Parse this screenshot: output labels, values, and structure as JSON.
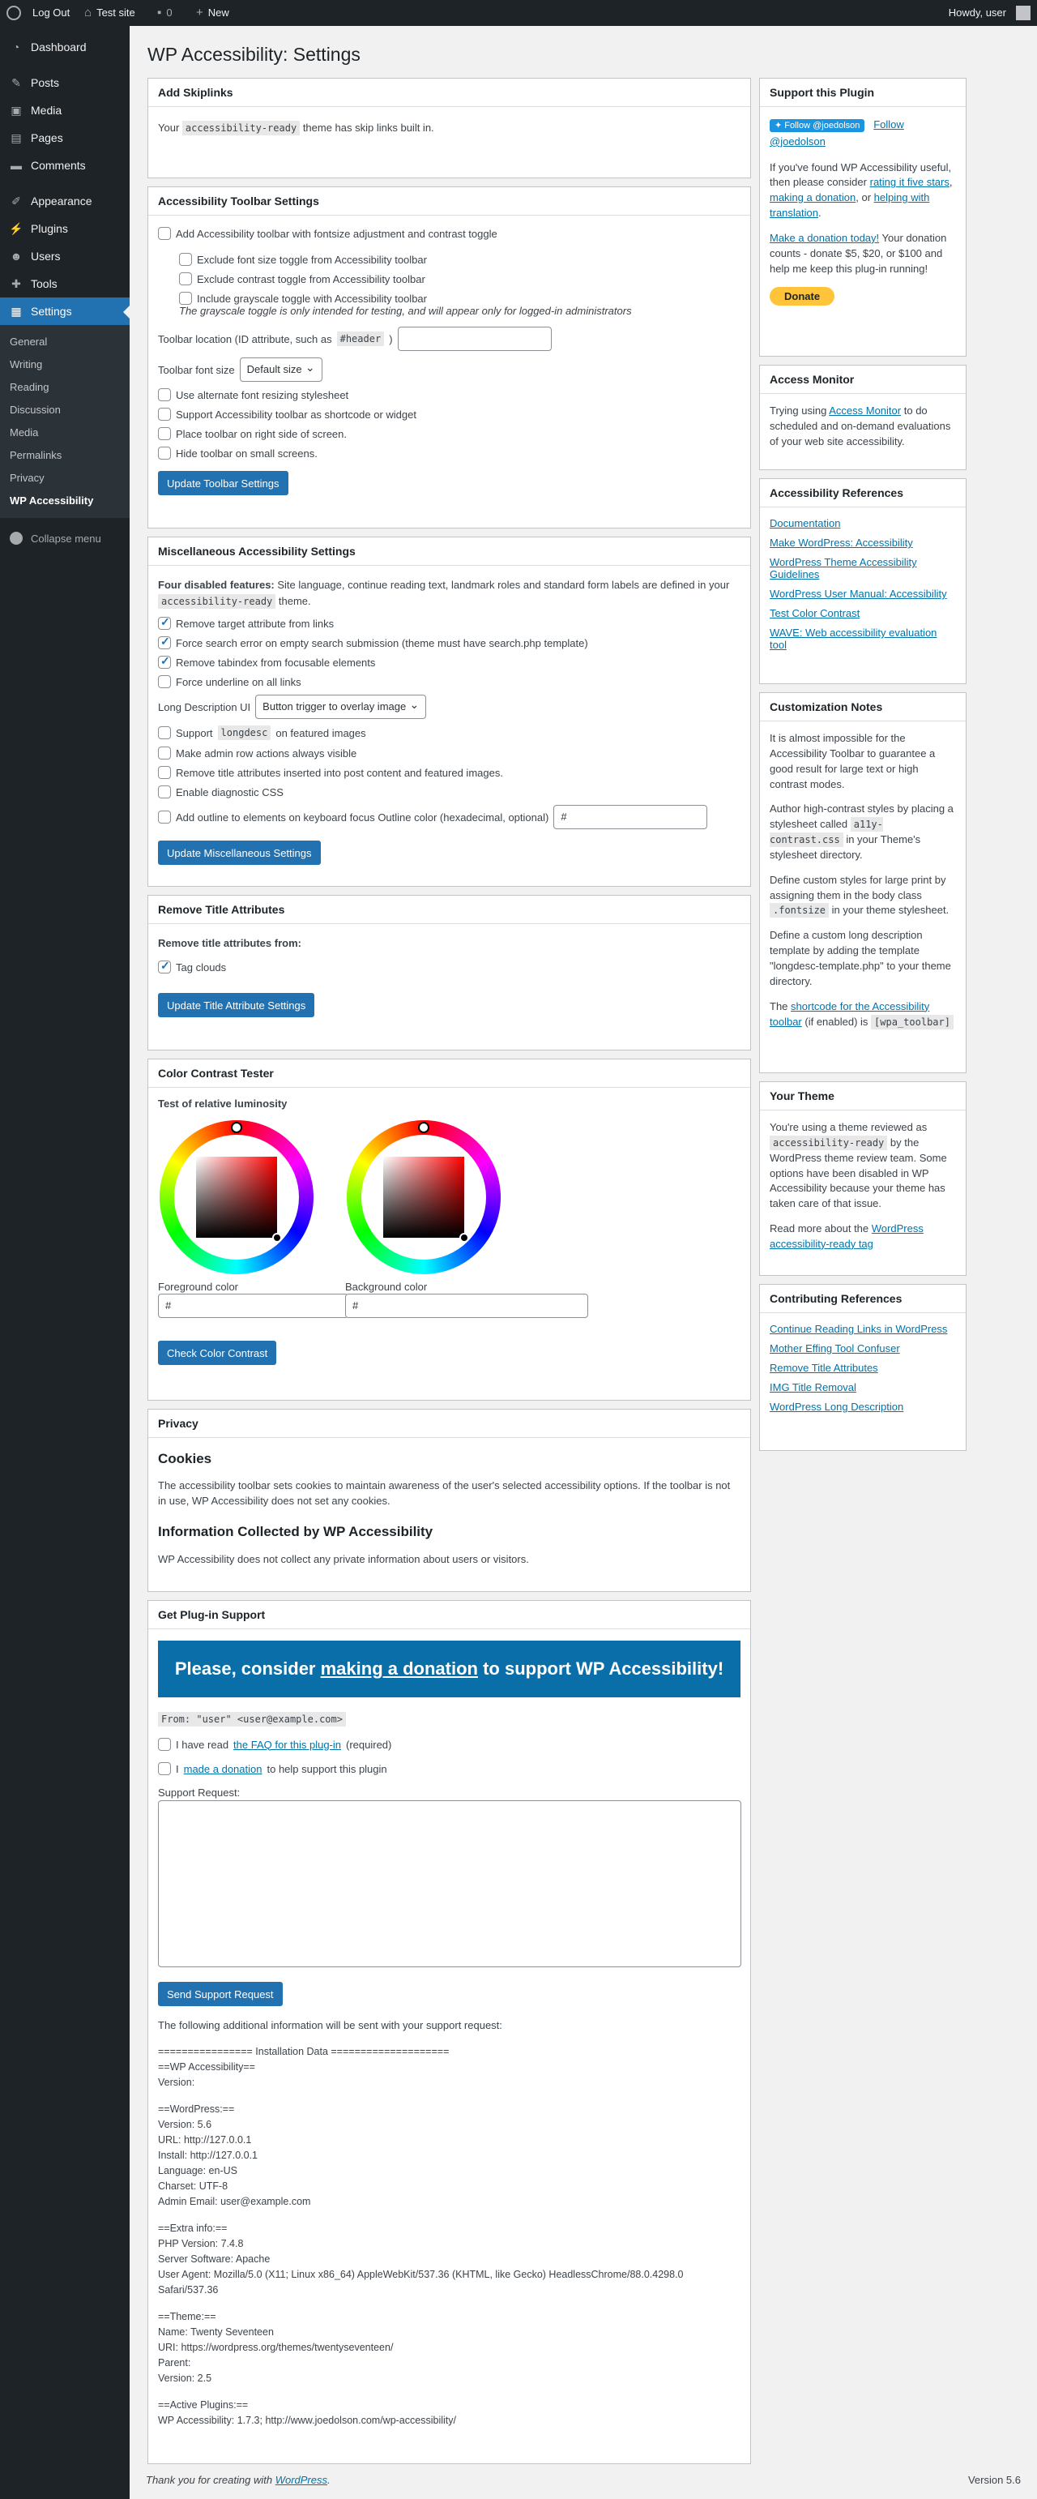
{
  "adminbar": {
    "logout": "Log Out",
    "site": "Test site",
    "comments": "0",
    "new": "New",
    "howdy": "Howdy, user"
  },
  "menu": {
    "dashboard": "Dashboard",
    "posts": "Posts",
    "media": "Media",
    "pages": "Pages",
    "comments": "Comments",
    "appearance": "Appearance",
    "plugins": "Plugins",
    "users": "Users",
    "tools": "Tools",
    "settings": "Settings",
    "collapse": "Collapse menu",
    "sub": [
      "General",
      "Writing",
      "Reading",
      "Discussion",
      "Media",
      "Permalinks",
      "Privacy",
      "WP Accessibility"
    ]
  },
  "page_title": "WP Accessibility: Settings",
  "skiplinks": {
    "title": "Add Skiplinks",
    "text_a": "Your",
    "code": "accessibility-ready",
    "text_b": "theme has skip links built in."
  },
  "toolbar": {
    "title": "Accessibility Toolbar Settings",
    "add": "Add Accessibility toolbar with fontsize adjustment and contrast toggle",
    "ex_font": "Exclude font size toggle from Accessibility toolbar",
    "ex_contrast": "Exclude contrast toggle from Accessibility toolbar",
    "grayscale": "Include grayscale toggle with Accessibility toolbar",
    "grayscale_note": "The grayscale toggle is only intended for testing, and will appear only for logged-in administrators",
    "location_a": "Toolbar location (ID attribute, such as",
    "location_code": "#header",
    "location_b": ")",
    "font_size_label": "Toolbar font size",
    "font_size_value": "Default size",
    "alt_font": "Use alternate font resizing stylesheet",
    "shortcode": "Support Accessibility toolbar as shortcode or widget",
    "right_side": "Place toolbar on right side of screen.",
    "hide_small": "Hide toolbar on small screens.",
    "button": "Update Toolbar Settings"
  },
  "misc": {
    "title": "Miscellaneous Accessibility Settings",
    "disabled_bold": "Four disabled features:",
    "disabled_text": "Site language, continue reading text, landmark roles and standard form labels are defined in your",
    "disabled_code": "accessibility-ready",
    "disabled_end": "theme.",
    "remove_target": "Remove target attribute from links",
    "force_search": "Force search error on empty search submission (theme must have search.php template)",
    "remove_tabindex": "Remove tabindex from focusable elements",
    "force_underline": "Force underline on all links",
    "longdesc_label": "Long Description UI",
    "longdesc_value": "Button trigger to overlay image",
    "support_a": "Support",
    "support_code": "longdesc",
    "support_b": "on featured images",
    "admin_rows": "Make admin row actions always visible",
    "remove_title": "Remove title attributes inserted into post content and featured images.",
    "diag_css": "Enable diagnostic CSS",
    "outline": "Add outline to elements on keyboard focus Outline color (hexadecimal, optional)",
    "outline_value": "#",
    "button": "Update Miscellaneous Settings"
  },
  "titles": {
    "title": "Remove Title Attributes",
    "subhead": "Remove title attributes from:",
    "tag_clouds": "Tag clouds",
    "button": "Update Title Attribute Settings"
  },
  "contrast": {
    "title": "Color Contrast Tester",
    "subhead": "Test of relative luminosity",
    "fg_label": "Foreground color",
    "fg_value": "#",
    "bg_label": "Background color",
    "bg_value": "#",
    "button": "Check Color Contrast"
  },
  "privacy": {
    "title": "Privacy",
    "cookies_h": "Cookies",
    "cookies_p": "The accessibility toolbar sets cookies to maintain awareness of the user's selected accessibility options. If the toolbar is not in use, WP Accessibility does not set any cookies.",
    "info_h": "Information Collected by WP Accessibility",
    "info_p": "WP Accessibility does not collect any private information about users or visitors."
  },
  "support": {
    "title": "Get Plug-in Support",
    "banner_a": "Please, consider",
    "banner_link": "making a donation",
    "banner_b": "to support WP Accessibility!",
    "from": "From: \"user\" <user@example.com>",
    "faq_a": "I have read",
    "faq_link": "the FAQ for this plug-in",
    "faq_b": "(required)",
    "don_a": "I",
    "don_link": "made a donation",
    "don_b": "to help support this plugin",
    "request_label": "Support Request:",
    "button": "Send Support Request",
    "additional": "The following additional information will be sent with your support request:",
    "info": [
      "================ Installation Data ====================",
      "==WP Accessibility==",
      "Version:",
      "",
      "==WordPress:==",
      "Version: 5.6",
      "URL: http://127.0.0.1",
      "Install: http://127.0.0.1",
      "Language: en-US",
      "Charset: UTF-8",
      "Admin Email: user@example.com",
      "",
      "==Extra info:==",
      "PHP Version: 7.4.8",
      "Server Software: Apache",
      "User Agent: Mozilla/5.0 (X11; Linux x86_64) AppleWebKit/537.36 (KHTML, like Gecko) HeadlessChrome/88.0.4298.0 Safari/537.36",
      "",
      "==Theme:==",
      "Name: Twenty Seventeen",
      "URI: https://wordpress.org/themes/twentyseventeen/",
      "Parent:",
      "Version: 2.5",
      "",
      "==Active Plugins:==",
      "WP Accessibility: 1.7.3; http://www.joedolson.com/wp-accessibility/"
    ]
  },
  "sb_support": {
    "title": "Support this Plugin",
    "twitter": "Follow @joedolson",
    "follow_a": "Follow",
    "follow_b": "@joedolson",
    "p1_a": "If you've found WP Accessibility useful, then please consider",
    "p1_l1": "rating it five stars",
    "p1_l2": "making a donation",
    "p1_or": ", or",
    "p1_l3": "helping with translation",
    "p2_link": "Make a donation today!",
    "p2_text": "Your donation counts - donate $5, $20, or $100 and help me keep this plug-in running!",
    "donate": "Donate"
  },
  "sb_monitor": {
    "title": "Access Monitor",
    "text_a": "Trying using",
    "link": "Access Monitor",
    "text_b": "to do scheduled and on-demand evaluations of your web site accessibility."
  },
  "sb_refs": {
    "title": "Accessibility References",
    "links": [
      "Documentation",
      "Make WordPress: Accessibility",
      "WordPress Theme Accessibility Guidelines",
      "WordPress User Manual: Accessibility",
      "Test Color Contrast",
      "WAVE: Web accessibility evaluation tool"
    ]
  },
  "sb_custom": {
    "title": "Customization Notes",
    "p1": "It is almost impossible for the Accessibility Toolbar to guarantee a good result for large text or high contrast modes.",
    "p2_a": "Author high-contrast styles by placing a stylesheet called",
    "p2_code": "a11y-contrast.css",
    "p2_b": "in your Theme's stylesheet directory.",
    "p3_a": "Define custom styles for large print by assigning them in the body class",
    "p3_code": ".fontsize",
    "p3_b": "in your theme stylesheet.",
    "p4": "Define a custom long description template by adding the template \"longdesc-template.php\" to your theme directory.",
    "p5_a": "The",
    "p5_link": "shortcode for the Accessibility toolbar",
    "p5_b": "(if enabled) is",
    "p5_code": "[wpa_toolbar]"
  },
  "sb_theme": {
    "title": "Your Theme",
    "p1_a": "You're using a theme reviewed as",
    "p1_code": "accessibility-ready",
    "p1_b": "by the WordPress theme review team. Some options have been disabled in WP Accessibility because your theme has taken care of that issue.",
    "p2_a": "Read more about the",
    "p2_link": "WordPress accessibility-ready tag"
  },
  "sb_contrib": {
    "title": "Contributing References",
    "links": [
      "Continue Reading Links in WordPress",
      "Mother Effing Tool Confuser",
      "Remove Title Attributes",
      "IMG Title Removal",
      "WordPress Long Description"
    ]
  },
  "footer": {
    "thanks": "Thank you for creating with",
    "wp": "WordPress",
    "version": "Version 5.6"
  }
}
